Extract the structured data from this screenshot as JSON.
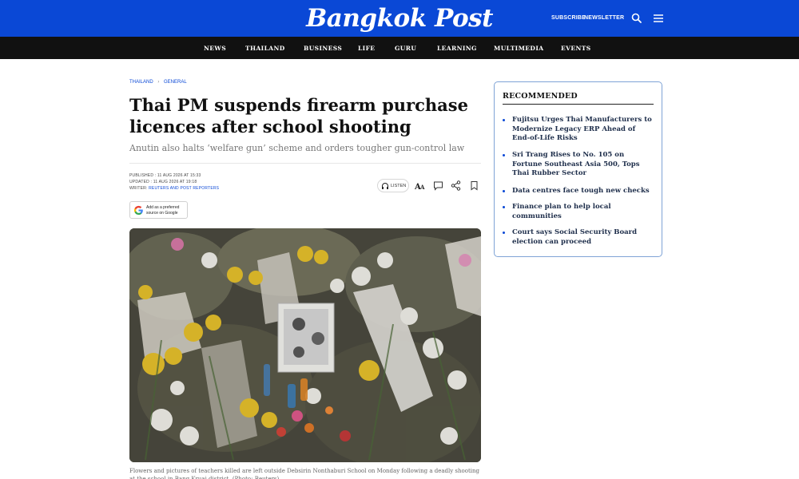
{
  "header": {
    "logo": "Bangkok Post",
    "subscribe": "SUBSCRIBE",
    "newsletter": "NEWSLETTER",
    "search_icon": "search-icon",
    "menu_icon": "hamburger-menu-icon"
  },
  "nav": {
    "items": [
      "NEWS",
      "THAILAND",
      "BUSINESS",
      "LIFE",
      "GURU",
      "LEARNING",
      "MULTIMEDIA",
      "EVENTS"
    ]
  },
  "breadcrumb": {
    "section": "THAILAND",
    "subsection": "GENERAL"
  },
  "article": {
    "title": "Thai PM suspends firearm purchase licences after school shooting",
    "subtitle": "Anutin also halts ‘welfare gun’ scheme and orders tougher gun-control law",
    "published_label": "PUBLISHED : ",
    "published": "11 AUG 2026 AT 15:33",
    "updated_label": "UPDATED : ",
    "updated": "11 AUG 2026 AT 19:18",
    "writer_label": "WRITER: ",
    "writer": "REUTERS AND POST REPORTERS",
    "listen": "LISTEN",
    "google_badge": "Add as a preferred source on Google",
    "caption": "Flowers and pictures of teachers killed are left outside Debsirin Nonthaburi School on Monday following a deadly shooting at the school in Bang Kruai district. (Photo: Reuters)"
  },
  "sidebar": {
    "title": "RECOMMENDED",
    "items": [
      "Fujitsu Urges Thai Manufacturers to Modernize Legacy ERP Ahead of End-of-Life Risks",
      "Sri Trang Rises to No. 105 on Fortune Southeast Asia 500, Tops Thai Rubber Sector",
      "Data centres face tough new checks",
      "Finance plan to help local communities",
      "Court says Social Security Board election can proceed"
    ]
  },
  "colors": {
    "brand_blue": "#0a48d6",
    "nav_black": "#111111",
    "sidebar_border": "#7fa3d6"
  }
}
